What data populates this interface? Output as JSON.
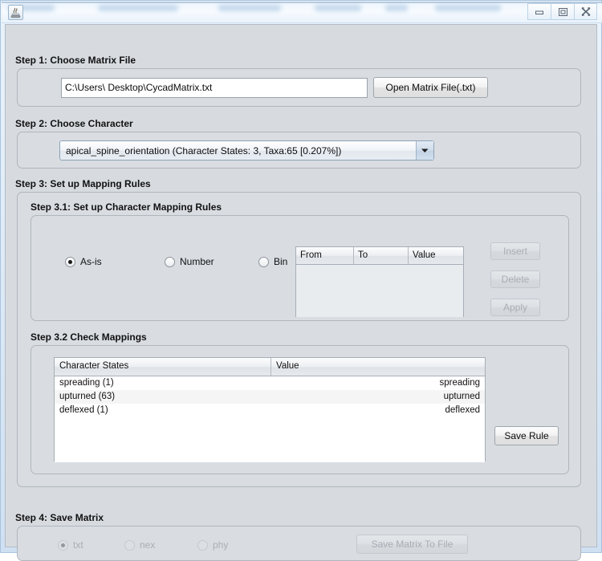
{
  "window": {
    "icon": "java-app-icon",
    "title": "",
    "controls": [
      {
        "name": "minimize-button",
        "glyph": "minimize-icon"
      },
      {
        "name": "maximize-button",
        "glyph": "maximize-icon"
      },
      {
        "name": "close-button",
        "glyph": "close-icon"
      }
    ]
  },
  "step1": {
    "label": "Step 1: Choose Matrix File",
    "path_value": "C:\\Users\\ Desktop\\CycadMatrix.txt",
    "path_placeholder": "",
    "open_button": "Open Matrix File(.txt)"
  },
  "step2": {
    "label": "Step 2: Choose Character",
    "selected_option": "apical_spine_orientation (Character States: 3, Taxa:65 [0.207%])",
    "arrow_icon": "chevron-down-icon"
  },
  "step3": {
    "label": "Step 3: Set up Mapping Rules",
    "step31": {
      "label": "Step 3.1: Set up Character Mapping Rules",
      "radios": [
        {
          "label": "As-is",
          "checked": true
        },
        {
          "label": "Number",
          "checked": false
        },
        {
          "label": "Bin",
          "checked": false
        }
      ],
      "rules_table": {
        "columns": [
          "From",
          "To",
          "Value"
        ],
        "rows": []
      },
      "buttons": [
        {
          "label": "Insert",
          "enabled": false
        },
        {
          "label": "Delete",
          "enabled": false
        },
        {
          "label": "Apply",
          "enabled": false
        }
      ]
    },
    "step32": {
      "label": "Step 3.2 Check Mappings",
      "table": {
        "columns": [
          "Character States",
          "Value"
        ],
        "rows": [
          {
            "state": "spreading (1)",
            "value": "spreading"
          },
          {
            "state": "upturned (63)",
            "value": "upturned"
          },
          {
            "state": "deflexed (1)",
            "value": "deflexed"
          }
        ]
      },
      "save_rule_button": "Save Rule"
    }
  },
  "step4": {
    "label": "Step 4: Save Matrix",
    "radios": [
      {
        "label": "txt",
        "checked": true,
        "enabled": false
      },
      {
        "label": "nex",
        "checked": false,
        "enabled": false
      },
      {
        "label": "phy",
        "checked": false,
        "enabled": false
      }
    ],
    "save_button": {
      "label": "Save Matrix To File",
      "enabled": false
    }
  },
  "colors": {
    "panel_bg": "#d9dde2",
    "content_bg": "#d7dbe0",
    "frame_blue": "#cfe0f2",
    "text": "#111111",
    "disabled_text": "#a9aeb5"
  }
}
